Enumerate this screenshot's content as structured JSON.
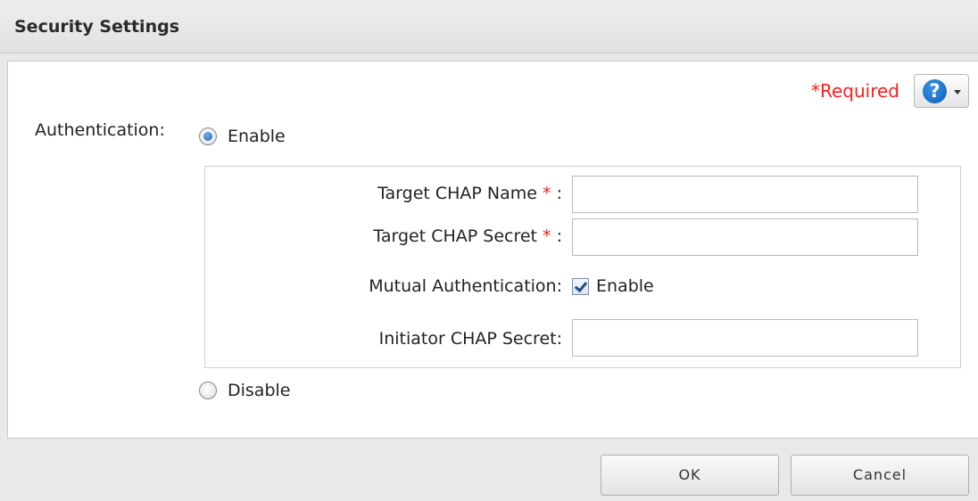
{
  "dialog": {
    "title": "Security Settings"
  },
  "header": {
    "required_label": "*Required",
    "help_icon": "question-icon",
    "help_icon_glyph": "?"
  },
  "authentication": {
    "label": "Authentication:",
    "enable_label": "Enable",
    "enable_selected": true,
    "disable_label": "Disable",
    "disable_selected": false
  },
  "chap": {
    "target_name_label": "Target CHAP Name",
    "target_name_value": "",
    "target_secret_label": "Target CHAP Secret",
    "target_secret_value": "",
    "required_star": "*",
    "colon": ":",
    "mutual_label": "Mutual Authentication:",
    "mutual_enable_label": "Enable",
    "mutual_checked": true,
    "initiator_secret_label": "Initiator CHAP Secret:",
    "initiator_secret_value": ""
  },
  "footer": {
    "ok_label": "OK",
    "cancel_label": "Cancel"
  },
  "colors": {
    "required_red": "#ff1a1a",
    "help_blue": "#0a5fb8"
  }
}
